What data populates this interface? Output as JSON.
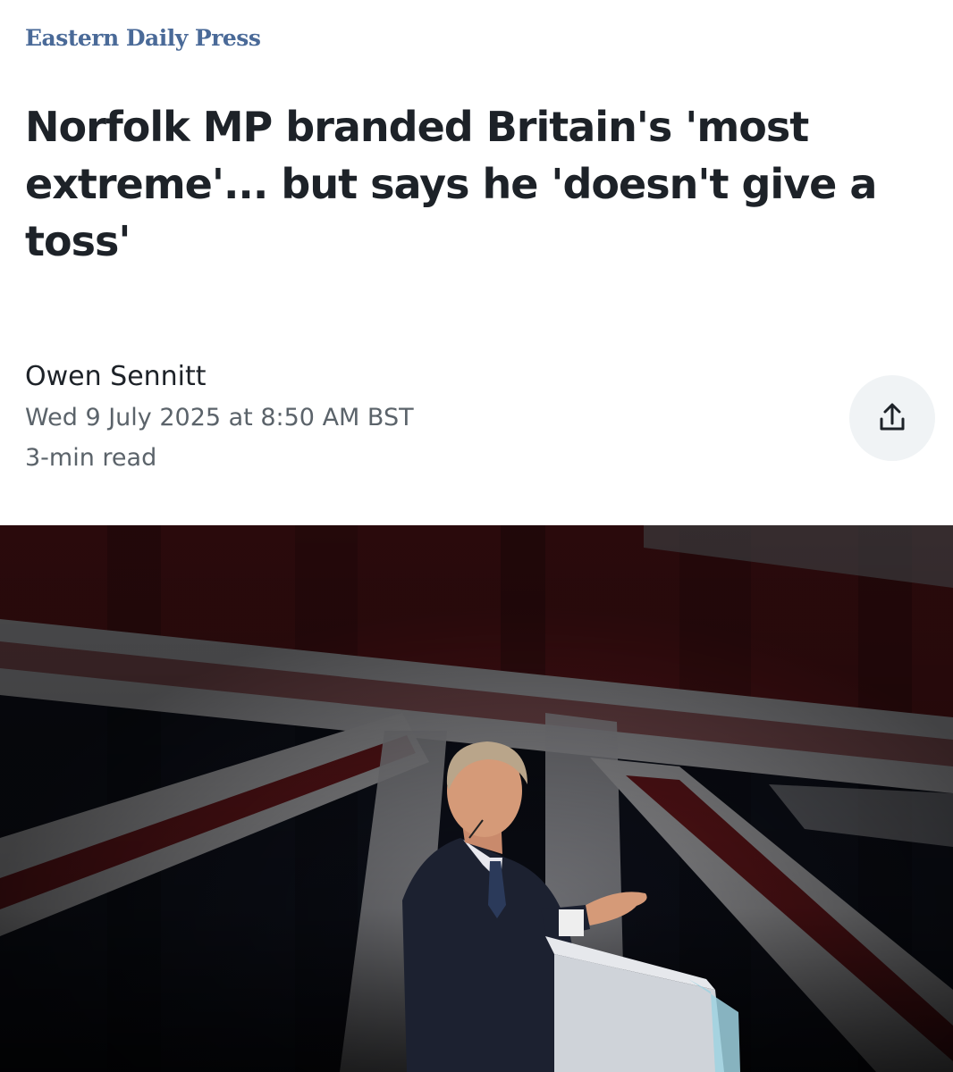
{
  "article": {
    "publisher": "Eastern Daily Press",
    "headline": "Norfolk MP branded Britain's 'most extreme'... but says he 'doesn't give a toss'",
    "author": "Owen Sennitt",
    "date": "Wed 9 July 2025 at 8:50 AM BST",
    "read_time": "3-min read"
  },
  "share": {
    "icon": "share-icon"
  },
  "hero_image": {
    "subject": "speaker-at-lectern-photo",
    "background": "union-flag"
  },
  "colors": {
    "publisher": "#4a6a98",
    "headline": "#1d2228",
    "meta": "#5b636a",
    "share_bg": "#f0f3f5",
    "flag_red": "#7a1b20",
    "flag_white": "#c9c9cd",
    "flag_navy": "#111522"
  }
}
